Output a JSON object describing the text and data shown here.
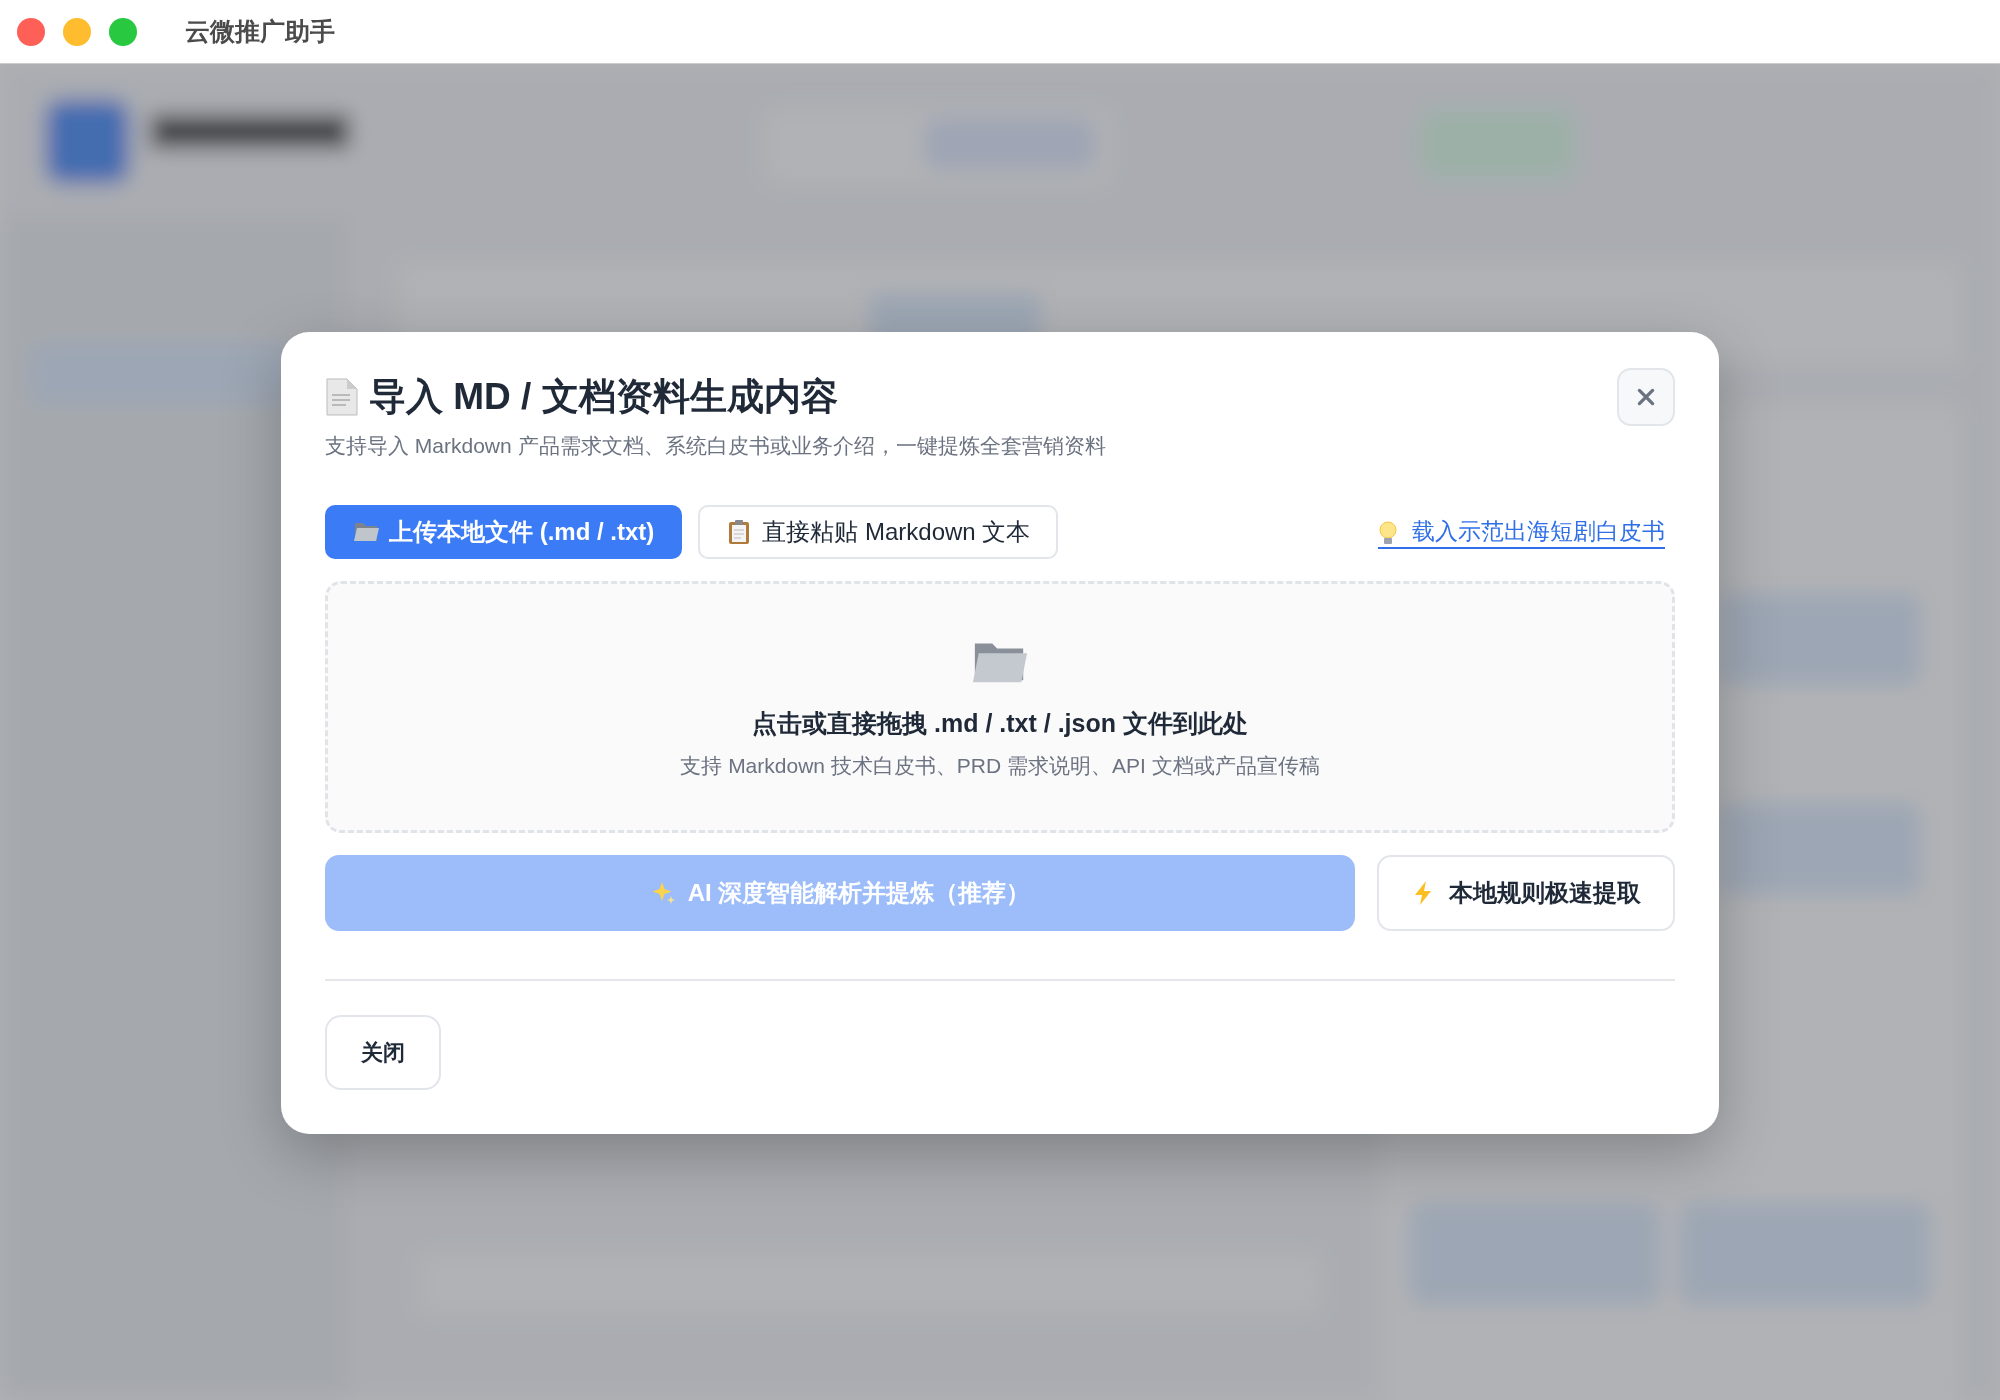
{
  "window": {
    "title": "云微推广助手"
  },
  "dialog": {
    "title": "导入 MD / 文档资料生成内容",
    "subtitle": "支持导入 Markdown 产品需求文档、系统白皮书或业务介绍，一键提炼全套营销资料",
    "tabs": [
      {
        "kind": "upload",
        "label": "上传本地文件 (.md / .txt)",
        "selected": true
      },
      {
        "kind": "paste",
        "label": "直接粘贴 Markdown 文本",
        "selected": false
      }
    ],
    "sample_link": "载入示范出海短剧白皮书",
    "dropzone": {
      "title": "点击或直接拖拽 .md / .txt / .json 文件到此处",
      "hint": "支持 Markdown 技术白皮书、PRD 需求说明、API 文档或产品宣传稿"
    },
    "actions": [
      {
        "kind": "ai",
        "label": "AI 深度智能解析并提炼（推荐）",
        "disabled": true
      },
      {
        "kind": "local",
        "label": "本地规则极速提取",
        "disabled": false
      }
    ],
    "footer_buttons": [
      "关闭"
    ]
  }
}
